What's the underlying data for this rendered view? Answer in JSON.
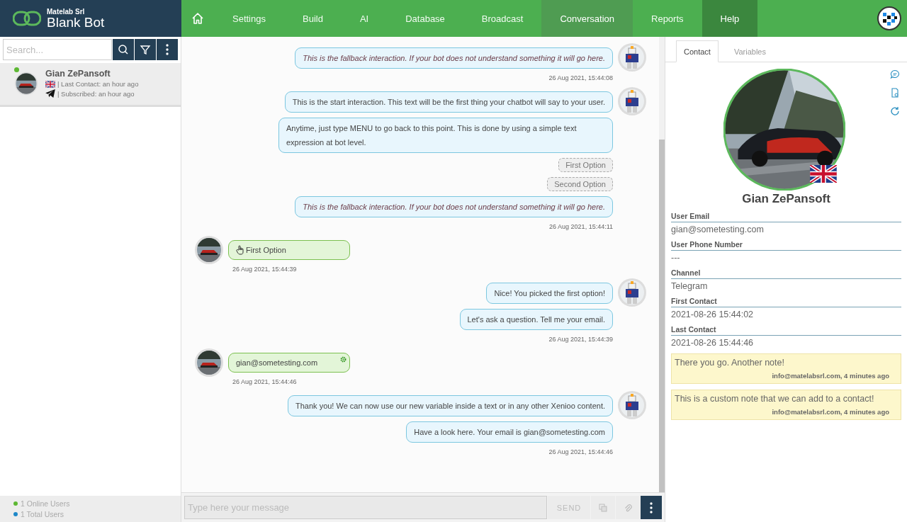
{
  "brand": {
    "company": "Matelab Srl",
    "bot": "Blank Bot"
  },
  "nav": [
    {
      "kind": "home",
      "selected": false,
      "hovered": false
    },
    {
      "kind": "tab",
      "label": "Settings",
      "selected": false,
      "hovered": false
    },
    {
      "kind": "tab",
      "label": "Build",
      "selected": false,
      "hovered": false
    },
    {
      "kind": "tab",
      "label": "AI",
      "selected": false,
      "hovered": false
    },
    {
      "kind": "tab",
      "label": "Database",
      "selected": false,
      "hovered": false
    },
    {
      "kind": "tab",
      "label": "Broadcast",
      "selected": false,
      "hovered": false
    },
    {
      "kind": "tab",
      "label": "Conversation",
      "selected": true,
      "hovered": false
    },
    {
      "kind": "tab",
      "label": "Reports",
      "selected": false,
      "hovered": false
    },
    {
      "kind": "tab",
      "label": "Help",
      "selected": false,
      "hovered": true
    }
  ],
  "search": {
    "placeholder": "Search..."
  },
  "contacts": [
    {
      "name": "Gian ZePansoft",
      "online": true,
      "selected": true,
      "last_contact": "| Last Contact: an hour ago",
      "subscribed": "| Subscribed: an hour ago"
    }
  ],
  "stats": [
    {
      "text": "1 Online Users",
      "color": "#5db833"
    },
    {
      "text": "1 Total Users",
      "color": "#1e88c8"
    }
  ],
  "conversation": [
    {
      "kind": "bot",
      "time": "26 Aug 2021, 15:44:08",
      "items": [
        {
          "kind": "text",
          "text": "This is the fallback interaction. If your bot does not understand something it will go here.",
          "italic": true
        }
      ]
    },
    {
      "kind": "bot",
      "time": "26 Aug 2021, 15:44:11",
      "items": [
        {
          "kind": "text",
          "text": "This is the start interaction. This text will be the first thing your chatbot will say to your user.",
          "italic": false
        },
        {
          "kind": "text",
          "text": "Anytime, just type MENU to go back to this point. This is done by using a simple text expression at bot level.",
          "italic": false
        },
        {
          "kind": "option",
          "text": "First Option"
        },
        {
          "kind": "option",
          "text": "Second Option"
        },
        {
          "kind": "text",
          "text": "This is the fallback interaction. If your bot does not understand something it will go here.",
          "italic": true
        }
      ]
    },
    {
      "kind": "user",
      "time": "26 Aug 2021, 15:44:39",
      "items": [
        {
          "kind": "click",
          "text": "First Option"
        }
      ]
    },
    {
      "kind": "bot",
      "time": "26 Aug 2021, 15:44:39",
      "items": [
        {
          "kind": "text",
          "text": "Nice! You picked the first option!",
          "italic": false
        },
        {
          "kind": "text",
          "text": "Let's ask a question. Tell me your email.",
          "italic": false
        }
      ]
    },
    {
      "kind": "user",
      "time": "26 Aug 2021, 15:44:46",
      "items": [
        {
          "kind": "input",
          "text": "gian@sometesting.com"
        }
      ]
    },
    {
      "kind": "bot",
      "time": "26 Aug 2021, 15:44:46",
      "items": [
        {
          "kind": "text",
          "text": "Thank you! We can now use our new variable inside a text or in any other Xenioo content.",
          "italic": false
        },
        {
          "kind": "text",
          "text": "Have a look here. Your email is gian@sometesting.com",
          "italic": false
        }
      ]
    }
  ],
  "composer": {
    "placeholder": "Type here your message",
    "send": "SEND",
    "disabled": true
  },
  "panel": {
    "tabs": [
      {
        "label": "Contact",
        "selected": true
      },
      {
        "label": "Variables",
        "selected": false
      }
    ],
    "name": "Gian ZePansoft",
    "fields": [
      {
        "label": "User Email",
        "value": "gian@sometesting.com"
      },
      {
        "label": "User Phone Number",
        "value": "---"
      },
      {
        "label": "Channel",
        "value": "Telegram"
      },
      {
        "label": "First Contact",
        "value": "2021-08-26 15:44:02"
      },
      {
        "label": "Last Contact",
        "value": "2021-08-26 15:44:46"
      }
    ],
    "notes": [
      {
        "text": "There you go. Another note!",
        "meta": "info@matelabsrl.com, 4 minutes ago"
      },
      {
        "text": "This is a custom note that we can add to a contact!",
        "meta": "info@matelabsrl.com, 4 minutes ago"
      }
    ]
  }
}
